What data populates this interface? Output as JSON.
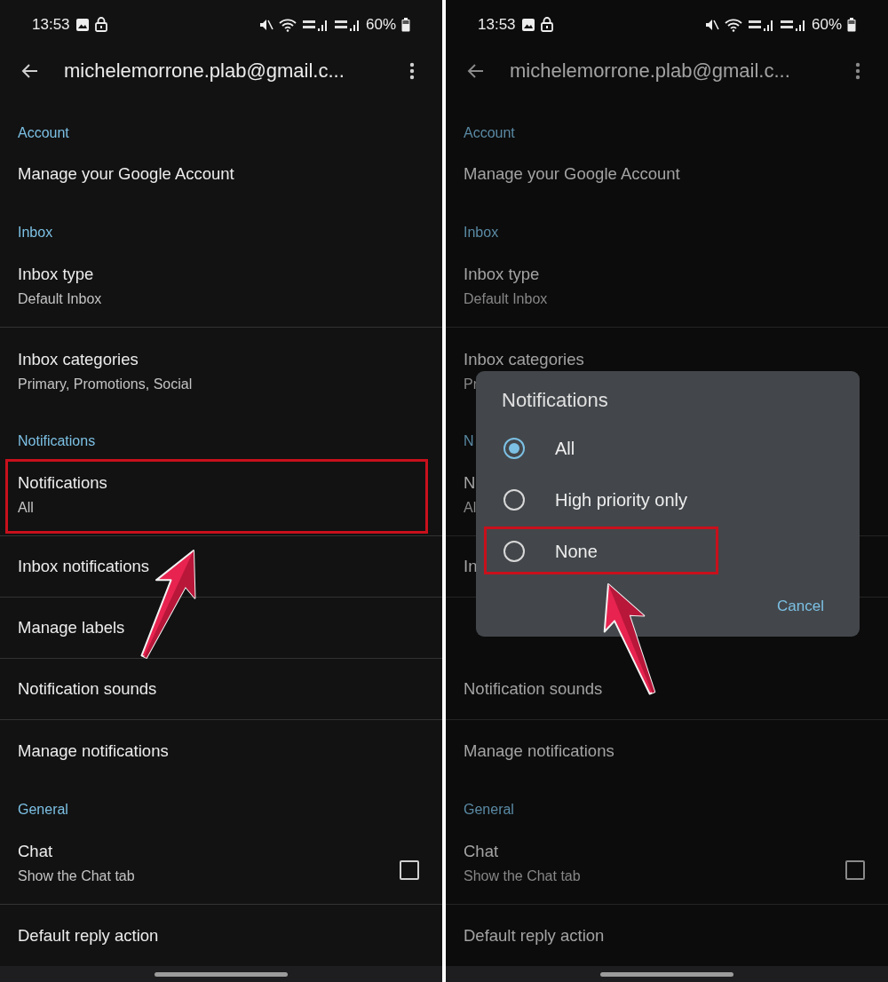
{
  "screens": [
    {
      "dimmed": false,
      "status_bar": {
        "time": "13:53",
        "battery": "60%"
      },
      "app_bar": {
        "title": "michelemorrone.plab@gmail.c..."
      },
      "sections": [
        {
          "header": "Account",
          "items": [
            {
              "title": "Manage your Google Account"
            }
          ]
        },
        {
          "header": "Inbox",
          "items": [
            {
              "title": "Inbox type",
              "subtitle": "Default Inbox"
            },
            {
              "title": "Inbox categories",
              "subtitle": "Primary, Promotions, Social"
            }
          ]
        },
        {
          "header": "Notifications",
          "items": [
            {
              "title": "Notifications",
              "subtitle": "All",
              "highlighted": true
            },
            {
              "title": "Inbox notifications"
            },
            {
              "title": "Manage labels"
            },
            {
              "title": "Notification sounds"
            },
            {
              "title": "Manage notifications"
            }
          ]
        },
        {
          "header": "General",
          "items": [
            {
              "title": "Chat",
              "subtitle": "Show the Chat tab",
              "kind": "checkbox",
              "checked": false
            },
            {
              "title": "Default reply action"
            }
          ]
        }
      ]
    },
    {
      "dimmed": true,
      "status_bar": {
        "time": "13:53",
        "battery": "60%"
      },
      "app_bar": {
        "title": "michelemorrone.plab@gmail.c..."
      },
      "sections": [
        {
          "header": "Account",
          "items": [
            {
              "title": "Manage your Google Account"
            }
          ]
        },
        {
          "header": "Inbox",
          "items": [
            {
              "title": "Inbox type",
              "subtitle": "Default Inbox"
            },
            {
              "title": "Inbox categories",
              "subtitle": "Pr"
            }
          ]
        },
        {
          "header": "N",
          "items": [
            {
              "title": "N",
              "subtitle": "Al"
            },
            {
              "title": "In"
            },
            {
              "kind": "covered"
            },
            {
              "title": "Notification sounds"
            },
            {
              "title": "Manage notifications"
            }
          ]
        },
        {
          "header": "General",
          "items": [
            {
              "title": "Chat",
              "subtitle": "Show the Chat tab",
              "kind": "checkbox",
              "checked": false
            },
            {
              "title": "Default reply action"
            }
          ]
        }
      ],
      "dialog": {
        "title": "Notifications",
        "options": [
          {
            "label": "All",
            "selected": true,
            "highlighted": false
          },
          {
            "label": "High priority only",
            "selected": false,
            "highlighted": false
          },
          {
            "label": "None",
            "selected": false,
            "highlighted": true
          }
        ],
        "cancel": "Cancel"
      }
    }
  ]
}
